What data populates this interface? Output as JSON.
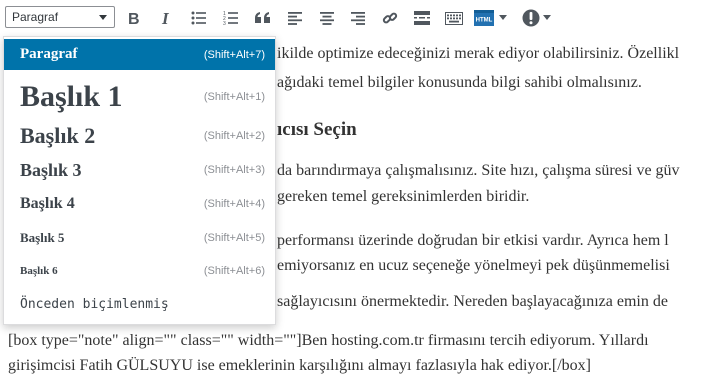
{
  "toolbar": {
    "format_value": "Paragraf",
    "buttons": [
      "bold-icon",
      "italic-icon",
      "bullet-list-icon",
      "numbered-list-icon",
      "blockquote-icon",
      "align-left-icon",
      "align-center-icon",
      "align-right-icon",
      "link-icon",
      "read-more-icon",
      "keyboard-icon",
      "html-icon",
      "info-icon"
    ],
    "html_label": "HTML"
  },
  "dropdown": {
    "items": [
      {
        "label": "Paragraf",
        "shortcut": "(Shift+Alt+7)"
      },
      {
        "label": "Başlık 1",
        "shortcut": "(Shift+Alt+1)"
      },
      {
        "label": "Başlık 2",
        "shortcut": "(Shift+Alt+2)"
      },
      {
        "label": "Başlık 3",
        "shortcut": "(Shift+Alt+3)"
      },
      {
        "label": "Başlık 4",
        "shortcut": "(Shift+Alt+4)"
      },
      {
        "label": "Başlık 5",
        "shortcut": "(Shift+Alt+5)"
      },
      {
        "label": "Başlık 6",
        "shortcut": "(Shift+Alt+6)"
      },
      {
        "label": "Önceden biçimlenmiş",
        "shortcut": ""
      }
    ]
  },
  "content": {
    "line1": "ikilde optimize edeceğinizi merak ediyor olabilirsiniz. Özellikl",
    "line2": "ağıdaki temel bilgiler konusunda bilgi sahibi olmalısınız.",
    "heading": "ıcısı Seçin",
    "line3": "da barındırmaya çalışmalısınız. Site hızı, çalışma süresi ve güv",
    "line4": "gereken temel gereksinimlerden biridir.",
    "line5": "performansı üzerinde doğrudan bir etkisi vardır. Ayrıca hem l",
    "line6": "emiyorsanız en ucuz seçeneğe yönelmeyi pek düşünmemelisi",
    "line7": "sağlayıcısını önermektedir. Nereden başlayacağınıza emin de",
    "line8": "[box type=\"note\" align=\"\" class=\"\" width=\"\"]Ben hosting.com.tr firmasını tercih ediyorum. Yıllardı",
    "line9": "girişimcisi Fatih GÜLSUYU ise emeklerinin karşılığını almayı fazlasıyla hak ediyor.[/box]"
  },
  "colors": {
    "active_bg": "#0073aa",
    "icon": "#50575e",
    "html_icon_bg": "#2271b1"
  }
}
